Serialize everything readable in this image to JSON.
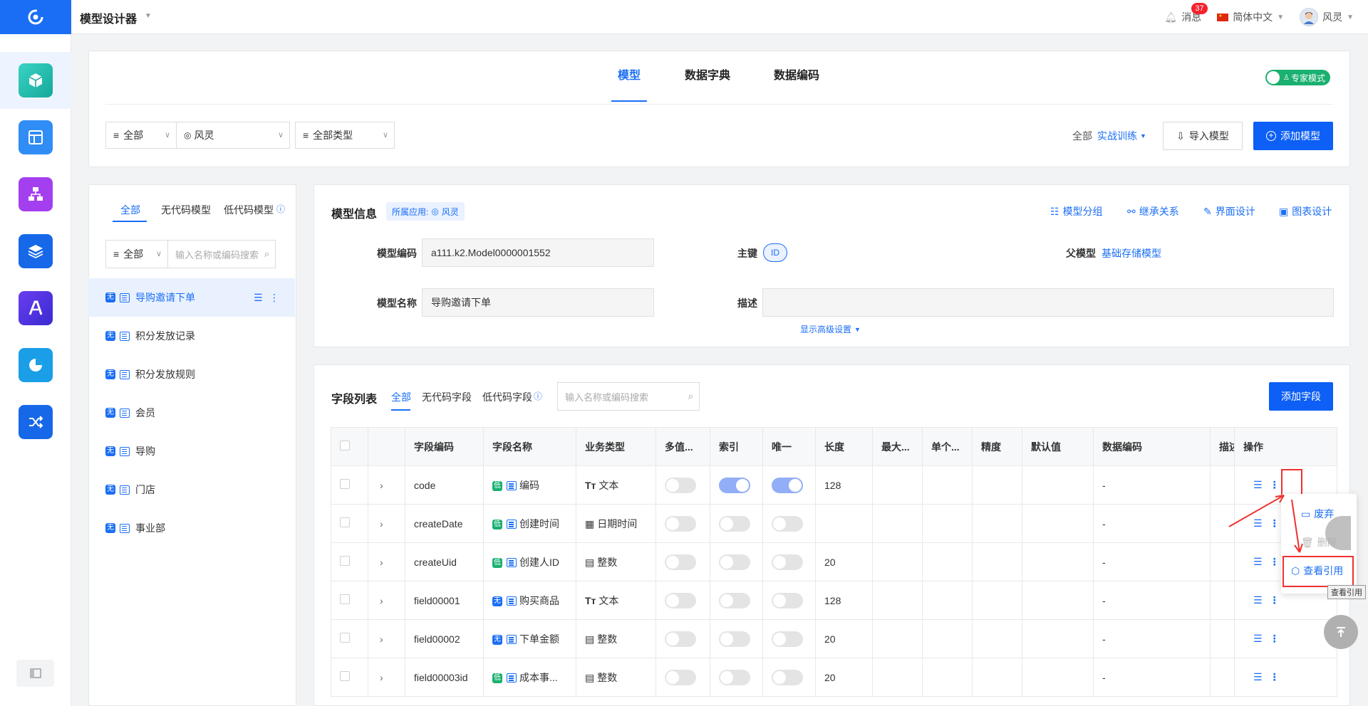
{
  "header": {
    "app_title": "模型设计器",
    "messages_label": "消息",
    "messages_count": "37",
    "language": "简体中文",
    "user_name": "风灵"
  },
  "top_tabs": [
    "模型",
    "数据字典",
    "数据编码"
  ],
  "expert_mode_label": "专家模式",
  "filter_bar": {
    "scope": "全部",
    "owner": "风灵",
    "type": "全部类型",
    "app_scope_label": "全部",
    "app_name": "实战训练",
    "import_button": "导入模型",
    "add_model_button": "添加模型"
  },
  "left_panel": {
    "tabs": [
      "全部",
      "无代码模型",
      "低代码模型"
    ],
    "filter_select": "全部",
    "search_placeholder": "输入名称或编码搜索",
    "models": [
      {
        "tag": "无",
        "name": "导购邀请下单"
      },
      {
        "tag": "无",
        "name": "积分发放记录"
      },
      {
        "tag": "无",
        "name": "积分发放规则"
      },
      {
        "tag": "无",
        "name": "会员"
      },
      {
        "tag": "无",
        "name": "导购"
      },
      {
        "tag": "无",
        "name": "门店"
      },
      {
        "tag": "无",
        "name": "事业部"
      }
    ]
  },
  "model_info": {
    "title": "模型信息",
    "app_tag_label": "所属应用:",
    "app_tag_value": "风灵",
    "actions": [
      "模型分组",
      "继承关系",
      "界面设计",
      "图表设计"
    ],
    "code_label": "模型编码",
    "code_value": "a111.k2.Model0000001552",
    "pk_label": "主键",
    "pk_value": "ID",
    "parent_label": "父模型",
    "parent_value": "基础存储模型",
    "name_label": "模型名称",
    "name_value": "导购邀请下单",
    "desc_label": "描述",
    "desc_value": "",
    "advanced_toggle": "显示高级设置"
  },
  "field_list": {
    "title": "字段列表",
    "tabs": [
      "全部",
      "无代码字段",
      "低代码字段"
    ],
    "search_placeholder": "输入名称或编码搜索",
    "add_button": "添加字段",
    "columns": [
      "字段编码",
      "字段名称",
      "业务类型",
      "多值...",
      "索引",
      "唯一",
      "长度",
      "最大...",
      "单个...",
      "精度",
      "默认值",
      "数据编码",
      "描述",
      "操作"
    ],
    "rows": [
      {
        "code": "code",
        "tag": "低",
        "name": "编码",
        "type_icon": "Tт",
        "type": "文本",
        "multi": false,
        "index": true,
        "unique": true,
        "length": "128",
        "data_code": "-"
      },
      {
        "code": "createDate",
        "tag": "低",
        "name": "创建时间",
        "type_icon": "▦",
        "type": "日期时间",
        "multi": false,
        "index": false,
        "unique": false,
        "length": "",
        "data_code": "-"
      },
      {
        "code": "createUid",
        "tag": "低",
        "name": "创建人ID",
        "type_icon": "▤",
        "type": "整数",
        "multi": false,
        "index": false,
        "unique": false,
        "length": "20",
        "data_code": "-"
      },
      {
        "code": "field00001",
        "tag": "无",
        "name": "购买商品",
        "type_icon": "Tт",
        "type": "文本",
        "multi": false,
        "index": false,
        "unique": false,
        "length": "128",
        "data_code": "-"
      },
      {
        "code": "field00002",
        "tag": "无",
        "name": "下单金额",
        "type_icon": "▤",
        "type": "整数",
        "multi": false,
        "index": false,
        "unique": false,
        "length": "20",
        "data_code": "-"
      },
      {
        "code": "field00003id",
        "tag": "低",
        "name": "成本事...",
        "type_icon": "▤",
        "type": "整数",
        "multi": false,
        "index": false,
        "unique": false,
        "length": "20",
        "data_code": "-"
      }
    ]
  },
  "row_menu": {
    "discard": "废弃",
    "delete": "删除",
    "view_refs": "查看引用",
    "tooltip": "查看引用"
  },
  "colors": {
    "primary": "#1a6ef5",
    "green": "#1ab070",
    "annotation_red": "#f03030"
  }
}
